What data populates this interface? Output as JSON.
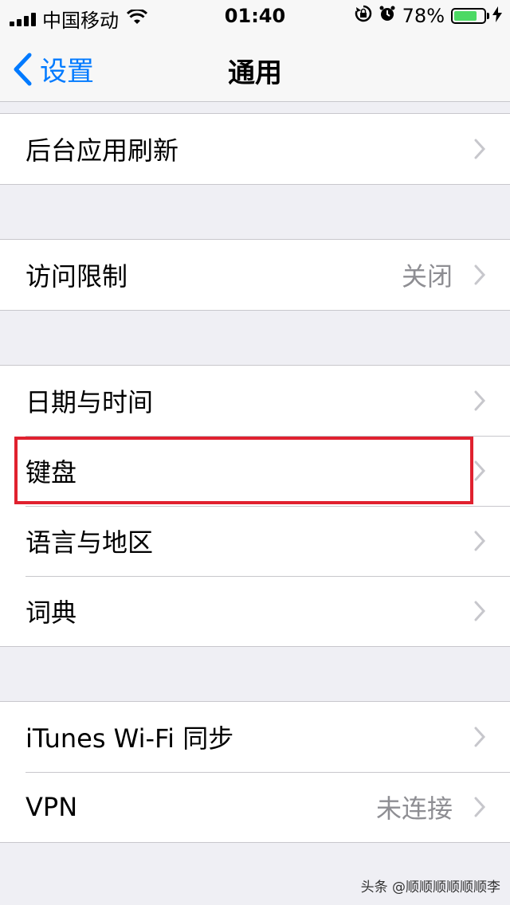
{
  "status_bar": {
    "carrier": "中国移动",
    "time": "01:40",
    "battery_percent": "78%",
    "icons": [
      "signal-icon",
      "wifi-icon",
      "rotation-lock-icon",
      "alarm-icon",
      "battery-icon",
      "charging-icon"
    ]
  },
  "nav": {
    "back_label": "设置",
    "title": "通用"
  },
  "groups": [
    {
      "rows": [
        {
          "label": "后台应用刷新",
          "value": ""
        }
      ]
    },
    {
      "rows": [
        {
          "label": "访问限制",
          "value": "关闭"
        }
      ]
    },
    {
      "rows": [
        {
          "label": "日期与时间",
          "value": ""
        },
        {
          "label": "键盘",
          "value": ""
        },
        {
          "label": "语言与地区",
          "value": ""
        },
        {
          "label": "词典",
          "value": ""
        }
      ]
    },
    {
      "rows": [
        {
          "label": "iTunes Wi-Fi 同步",
          "value": ""
        },
        {
          "label": "VPN",
          "value": "未连接"
        }
      ]
    }
  ],
  "highlighted_row": "键盘",
  "watermark": "头条 @顺顺顺顺顺顺李",
  "colors": {
    "accent": "#007aff",
    "highlight": "#e0212f",
    "background": "#efeff4"
  }
}
